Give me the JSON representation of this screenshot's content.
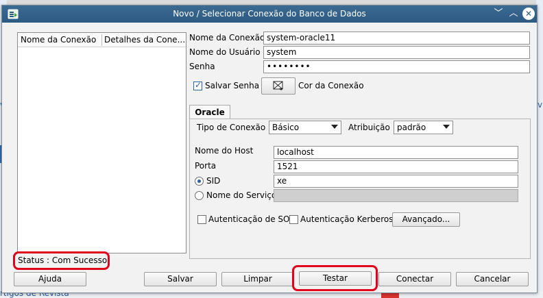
{
  "window": {
    "title": "Novo / Selecionar Conexão do Banco de Dados"
  },
  "background": {
    "link_top": "v",
    "link_mid": "v",
    "link_bottom": "rtigos de Revista"
  },
  "list": {
    "columns": [
      "Nome da Conexão",
      "Detalhes da Cone..."
    ]
  },
  "form": {
    "connection_name_label": "Nome da Conexão",
    "connection_name_value": "system-oracle11",
    "user_label": "Nome do Usuário",
    "user_value": "system",
    "password_label": "Senha",
    "password_value": "••••••••",
    "save_password_label": "Salvar Senha",
    "save_password_checked": true,
    "color_label": "Cor da Conexão"
  },
  "tab": {
    "label": "Oracle",
    "connection_type_label": "Tipo de Conexão",
    "connection_type_value": "Básico",
    "role_label": "Atribuição",
    "role_value": "padrão",
    "host_label": "Nome do Host",
    "host_value": "localhost",
    "port_label": "Porta",
    "port_value": "1521",
    "sid_label": "SID",
    "sid_value": "xe",
    "service_label": "Nome do Serviço",
    "os_auth_label": "Autenticação de SO",
    "kerberos_label": "Autenticação Kerberos",
    "advanced_button": "Avançado..."
  },
  "status": {
    "text": "Status : Com Sucesso"
  },
  "buttons": {
    "help": "Ajuda",
    "save": "Salvar",
    "clear": "Limpar",
    "test": "Testar",
    "connect": "Conectar",
    "cancel": "Cancelar"
  },
  "colors": {
    "titlebar": "#2c5a82",
    "highlight": "#e0001a",
    "accent": "#2f63a0"
  }
}
